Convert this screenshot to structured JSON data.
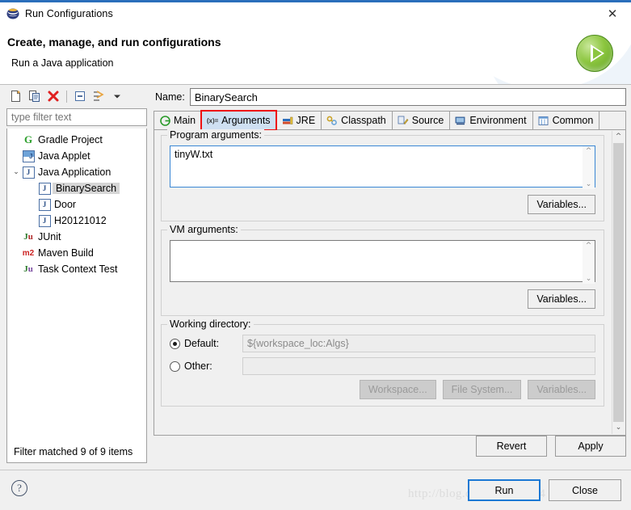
{
  "window": {
    "title": "Run Configurations",
    "icon": "eclipse-sphere-icon",
    "close_label": "✕"
  },
  "header": {
    "title": "Create, manage, and run configurations",
    "subtitle": "Run a Java application",
    "run_icon": "green-play-icon"
  },
  "toolbar": {
    "buttons": [
      {
        "name": "new-launch-configuration",
        "icon": "new-document-icon"
      },
      {
        "name": "duplicate-configuration",
        "icon": "copy-icon"
      },
      {
        "name": "delete-configuration",
        "icon": "red-x-icon",
        "glyph": "✖"
      },
      {
        "name": "collapse-all",
        "icon": "collapse-all-icon"
      },
      {
        "name": "filter-configurations",
        "icon": "filter-arrow-icon"
      },
      {
        "name": "view-menu",
        "icon": "chevron-down-icon",
        "glyph": "▾"
      }
    ]
  },
  "filter": {
    "placeholder": "type filter text",
    "value": ""
  },
  "tree": {
    "items": [
      {
        "label": "Gradle Project",
        "icon": "gradle-icon",
        "glyph": "G",
        "level": 1,
        "selected": false,
        "expandable": false
      },
      {
        "label": "Java Applet",
        "icon": "java-applet-icon",
        "glyph": "J",
        "level": 1,
        "selected": false,
        "expandable": false
      },
      {
        "label": "Java Application",
        "icon": "java-application-icon",
        "glyph": "J",
        "level": 0,
        "selected": false,
        "expandable": true,
        "expanded": true
      },
      {
        "label": "BinarySearch",
        "icon": "java-launch-icon",
        "glyph": "J",
        "level": 2,
        "selected": true,
        "expandable": false
      },
      {
        "label": "Door",
        "icon": "java-launch-icon",
        "glyph": "J",
        "level": 2,
        "selected": false,
        "expandable": false
      },
      {
        "label": "H20121012",
        "icon": "java-launch-icon",
        "glyph": "J",
        "level": 2,
        "selected": false,
        "expandable": false
      },
      {
        "label": "JUnit",
        "icon": "junit-icon",
        "glyph": "Ju",
        "level": 1,
        "selected": false,
        "expandable": false
      },
      {
        "label": "Maven Build",
        "icon": "maven-icon",
        "glyph": "m2",
        "level": 1,
        "selected": false,
        "expandable": false
      },
      {
        "label": "Task Context Test",
        "icon": "task-context-test-icon",
        "glyph": "Ju",
        "level": 1,
        "selected": false,
        "expandable": false
      }
    ],
    "status": "Filter matched 9 of 9 items"
  },
  "name_field": {
    "label": "Name:",
    "value": "BinarySearch"
  },
  "tabs": [
    {
      "label": "Main",
      "icon": "main-tab-icon",
      "glyph": "Ⓖ",
      "active": false
    },
    {
      "label": "Arguments",
      "icon": "arguments-tab-icon",
      "glyph": "(x)=",
      "active": true,
      "highlighted": true
    },
    {
      "label": "JRE",
      "icon": "jre-tab-icon",
      "glyph": "▤",
      "active": false
    },
    {
      "label": "Classpath",
      "icon": "classpath-tab-icon",
      "glyph": "⚙",
      "active": false
    },
    {
      "label": "Source",
      "icon": "source-tab-icon",
      "glyph": "✎",
      "active": false
    },
    {
      "label": "Environment",
      "icon": "environment-tab-icon",
      "glyph": "■",
      "active": false
    },
    {
      "label": "Common",
      "icon": "common-tab-icon",
      "glyph": "☰",
      "active": false
    }
  ],
  "program_arguments": {
    "group_label": "Program arguments:",
    "value": "tinyW.txt",
    "variables_button": "Variables...",
    "focused": true
  },
  "vm_arguments": {
    "group_label": "VM arguments:",
    "value": "",
    "variables_button": "Variables...",
    "focused": false
  },
  "working_directory": {
    "group_label": "Working directory:",
    "default_label": "Default:",
    "default_value": "${workspace_loc:Algs}",
    "default_selected": true,
    "other_label": "Other:",
    "other_value": "",
    "other_selected": false,
    "buttons": [
      {
        "label": "Workspace...",
        "disabled": true
      },
      {
        "label": "File System...",
        "disabled": true
      },
      {
        "label": "Variables...",
        "disabled": true
      }
    ]
  },
  "action_buttons": {
    "revert": "Revert",
    "apply": "Apply"
  },
  "footer": {
    "help_glyph": "?",
    "run": "Run",
    "close": "Close"
  },
  "watermark": "http://blog.csdn.net/liulin4",
  "colors": {
    "accent_blue": "#2a6ebb",
    "tab_active": "#cfe0f2",
    "highlight_red": "#ee1111",
    "focus_blue": "#3a87d4",
    "run_green": "#8cc63f"
  }
}
